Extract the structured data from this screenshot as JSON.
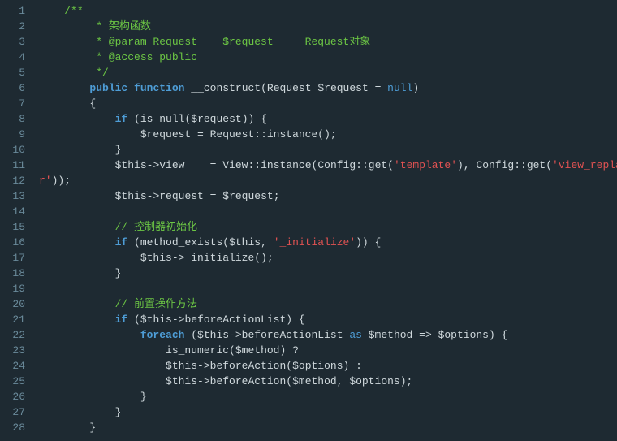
{
  "lineCount": 28,
  "tokens": [
    [
      [
        "    ",
        "p"
      ],
      [
        "/**",
        "c"
      ]
    ],
    [
      [
        "         * 架构函数",
        "c"
      ]
    ],
    [
      [
        "         * @param Request    $request     Request对象",
        "c"
      ]
    ],
    [
      [
        "         * @access public",
        "c"
      ]
    ],
    [
      [
        "         */",
        "c"
      ]
    ],
    [
      [
        "        ",
        "p"
      ],
      [
        "public",
        "k"
      ],
      [
        " ",
        "p"
      ],
      [
        "function",
        "k"
      ],
      [
        " ",
        "p"
      ],
      [
        "__construct",
        "f"
      ],
      [
        "(",
        "p"
      ],
      [
        "Request ",
        "t"
      ],
      [
        "$request",
        "v"
      ],
      [
        " = ",
        "p"
      ],
      [
        "null",
        "k2"
      ],
      [
        ")",
        "p"
      ]
    ],
    [
      [
        "        {",
        "p"
      ]
    ],
    [
      [
        "            ",
        "p"
      ],
      [
        "if",
        "k"
      ],
      [
        " (",
        "p"
      ],
      [
        "is_null",
        "f"
      ],
      [
        "(",
        "p"
      ],
      [
        "$request",
        "v"
      ],
      [
        ")) {",
        "p"
      ]
    ],
    [
      [
        "                ",
        "p"
      ],
      [
        "$request",
        "v"
      ],
      [
        " = ",
        "p"
      ],
      [
        "Request",
        "t"
      ],
      [
        "::",
        "p"
      ],
      [
        "instance",
        "f"
      ],
      [
        "();",
        "p"
      ]
    ],
    [
      [
        "            }",
        "p"
      ]
    ],
    [
      [
        "            ",
        "p"
      ],
      [
        "$this",
        "v"
      ],
      [
        "->",
        "p"
      ],
      [
        "view",
        "v"
      ],
      [
        "    = ",
        "p"
      ],
      [
        "View",
        "t"
      ],
      [
        "::",
        "p"
      ],
      [
        "instance",
        "f"
      ],
      [
        "(",
        "p"
      ],
      [
        "Config",
        "t"
      ],
      [
        "::",
        "p"
      ],
      [
        "get",
        "f"
      ],
      [
        "(",
        "p"
      ],
      [
        "'template'",
        "s"
      ],
      [
        "), ",
        "p"
      ],
      [
        "Config",
        "t"
      ],
      [
        "::",
        "p"
      ],
      [
        "get",
        "f"
      ],
      [
        "(",
        "p"
      ],
      [
        "'view_replace_st",
        "s"
      ]
    ],
    [
      [
        "r'",
        "s"
      ],
      [
        "));",
        "p"
      ]
    ],
    [
      [
        "            ",
        "p"
      ],
      [
        "$this",
        "v"
      ],
      [
        "->",
        "p"
      ],
      [
        "request",
        "v"
      ],
      [
        " = ",
        "p"
      ],
      [
        "$request",
        "v"
      ],
      [
        ";",
        "p"
      ]
    ],
    [
      [
        "",
        "p"
      ]
    ],
    [
      [
        "            ",
        "p"
      ],
      [
        "// 控制器初始化",
        "c"
      ]
    ],
    [
      [
        "            ",
        "p"
      ],
      [
        "if",
        "k"
      ],
      [
        " (",
        "p"
      ],
      [
        "method_exists",
        "f"
      ],
      [
        "(",
        "p"
      ],
      [
        "$this",
        "v"
      ],
      [
        ", ",
        "p"
      ],
      [
        "'_initialize'",
        "s"
      ],
      [
        ")) {",
        "p"
      ]
    ],
    [
      [
        "                ",
        "p"
      ],
      [
        "$this",
        "v"
      ],
      [
        "->",
        "p"
      ],
      [
        "_initialize",
        "f"
      ],
      [
        "();",
        "p"
      ]
    ],
    [
      [
        "            }",
        "p"
      ]
    ],
    [
      [
        "",
        "p"
      ]
    ],
    [
      [
        "            ",
        "p"
      ],
      [
        "// 前置操作方法",
        "c"
      ]
    ],
    [
      [
        "            ",
        "p"
      ],
      [
        "if",
        "k"
      ],
      [
        " (",
        "p"
      ],
      [
        "$this",
        "v"
      ],
      [
        "->",
        "p"
      ],
      [
        "beforeActionList",
        "v"
      ],
      [
        ") {",
        "p"
      ]
    ],
    [
      [
        "                ",
        "p"
      ],
      [
        "foreach",
        "k"
      ],
      [
        " (",
        "p"
      ],
      [
        "$this",
        "v"
      ],
      [
        "->",
        "p"
      ],
      [
        "beforeActionList",
        "v"
      ],
      [
        " ",
        "p"
      ],
      [
        "as",
        "k2"
      ],
      [
        " ",
        "p"
      ],
      [
        "$method",
        "v"
      ],
      [
        " => ",
        "p"
      ],
      [
        "$options",
        "v"
      ],
      [
        ") {",
        "p"
      ]
    ],
    [
      [
        "                    ",
        "p"
      ],
      [
        "is_numeric",
        "f"
      ],
      [
        "(",
        "p"
      ],
      [
        "$method",
        "v"
      ],
      [
        ") ?",
        "p"
      ]
    ],
    [
      [
        "                    ",
        "p"
      ],
      [
        "$this",
        "v"
      ],
      [
        "->",
        "p"
      ],
      [
        "beforeAction",
        "f"
      ],
      [
        "(",
        "p"
      ],
      [
        "$options",
        "v"
      ],
      [
        ") :",
        "p"
      ]
    ],
    [
      [
        "                    ",
        "p"
      ],
      [
        "$this",
        "v"
      ],
      [
        "->",
        "p"
      ],
      [
        "beforeAction",
        "f"
      ],
      [
        "(",
        "p"
      ],
      [
        "$method",
        "v"
      ],
      [
        ", ",
        "p"
      ],
      [
        "$options",
        "v"
      ],
      [
        ");",
        "p"
      ]
    ],
    [
      [
        "                }",
        "p"
      ]
    ],
    [
      [
        "            }",
        "p"
      ]
    ],
    [
      [
        "        }",
        "p"
      ]
    ]
  ]
}
